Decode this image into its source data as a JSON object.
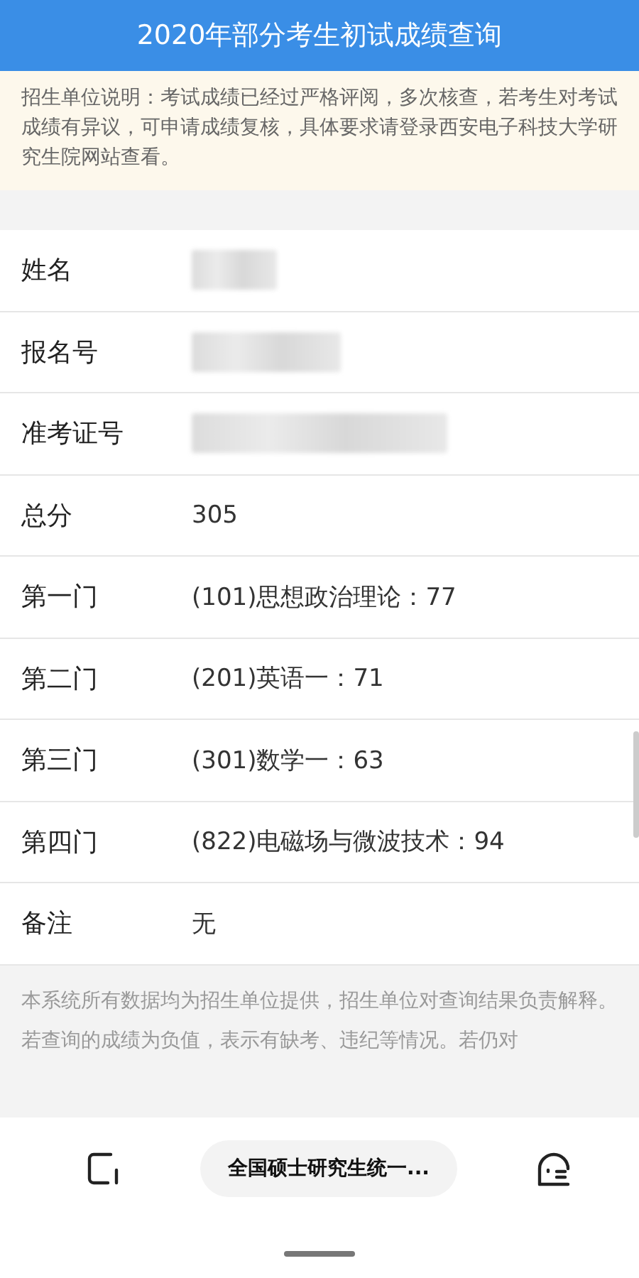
{
  "header": {
    "title": "2020年部分考生初试成绩查询"
  },
  "notice": "招生单位说明：考试成绩已经过严格评阅，多次核查，若考生对考试成绩有异议，可申请成绩复核，具体要求请登录西安电子科技大学研究生院网站查看。",
  "rows": [
    {
      "label": "姓名",
      "kind": "masked"
    },
    {
      "label": "报名号",
      "kind": "masked"
    },
    {
      "label": "准考证号",
      "kind": "masked"
    },
    {
      "label": "总分",
      "kind": "text",
      "value": "305"
    },
    {
      "label": "第一门",
      "kind": "text",
      "value": "(101)思想政治理论：77"
    },
    {
      "label": "第二门",
      "kind": "text",
      "value": "(201)英语一：71"
    },
    {
      "label": "第三门",
      "kind": "text",
      "value": "(301)数学一：63"
    },
    {
      "label": "第四门",
      "kind": "text",
      "value": "(822)电磁场与微波技术：94"
    },
    {
      "label": "备注",
      "kind": "text",
      "value": "无"
    }
  ],
  "footer_notes": [
    "本系统所有数据均为招生单位提供，招生单位对查询结果负责解释。",
    "若查询的成绩为负值，表示有缺考、违纪等情况。若仍对"
  ],
  "browser_bar": {
    "page_title": "全国硕士研究生统一..."
  }
}
